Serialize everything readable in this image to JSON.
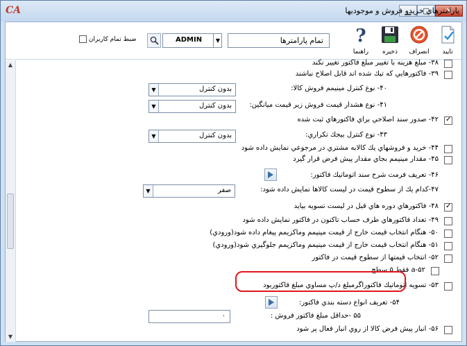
{
  "window": {
    "title": "پارامترهاي خريدو فروش و موجوديها",
    "logo": "CA",
    "buttons": {
      "minimize": "▁",
      "maximize": "▢",
      "close": "✕"
    }
  },
  "toolbar": {
    "confirm": "تاييد",
    "cancel": "انصراف",
    "save": "ذخيره",
    "help": "راهنما",
    "param_select": "تمام پارامترها",
    "user_value": "ADMIN",
    "record_all_users": "ضبط تمام كاربران"
  },
  "rows": {
    "r38": "۳۸- مبلغ هزينه با تغيير مبلغ فاكتور تغيير نكند",
    "r39": "۳۹- فاكتورهايي كه تيك شده اند قابل اصلاح نباشند",
    "r40": "۴۰- نوع كنترل مينيمم فروش كالا:",
    "r40_value": "بدون كنترل",
    "r41": "۴۱- نوع هشدار قيمت فروش زير قيمت ميانگين:",
    "r41_value": "بدون كنترل",
    "r42": "۴۲- صدور سند اصلاحي براي فاكتورهاي ثبت شده",
    "r43": "۴۳- نوع كنترل بيجك تكراري:",
    "r43_value": "بدون كنترل",
    "r44": "۴۴- خريد و فروشهاي يك كالابه مشتري در مرجوعي نمايش داده شود",
    "r45": "۴۵- مقدار مينيمم بجاي مقدار پيش فرض قرار گيرد",
    "r46": "۴۶- تعريف فرمت شرح سند اتوماتيك فاكتور:",
    "r47": "۴۷-كدام يك از سطوح قيمت در ليست كالاها نمايش داده شود:",
    "r47_value": "صفر",
    "r48": "۴۸- فاكتورهاي دوره هاي قبل در ليست تسويه بيايد",
    "r49": "۴۹- تعداد فاكتورهاي طرف حساب تاكنون در فاكتور نمايش داده شود",
    "r50": "۵۰- هنگام انتخاب قيمت خارج از قيمت مينيمم وماكزيمم پيغام داده شود(ورودي)",
    "r51": "۵۱- هنگام انتخاب قيمت خارج از قيمت مينيمم وماكزيمم جلوگيري شود(ورودي)",
    "r52": "۵۲- انتخاب قيمتها از سطوح قيمت در فاكتور",
    "r52a": "۵۲-a فقط ۵ سطح",
    "r53": "۵۳- تسويه اتوماتيك فاكتوراگرمبلغ د/پ مساوي مبلغ فاكتوربود",
    "r54": "۵۴- تعريف انواع دسته بندي فاكتور:",
    "r55": "۵۵ -حداقل مبلغ فاكتور فروش :",
    "r55_value": "۰",
    "r56": "۵۶- انبار پيش فرض كالا از روي انبار فعال پر شود"
  },
  "colors": {
    "highlight": "#e0161b",
    "accent": "#3a6ea5"
  }
}
